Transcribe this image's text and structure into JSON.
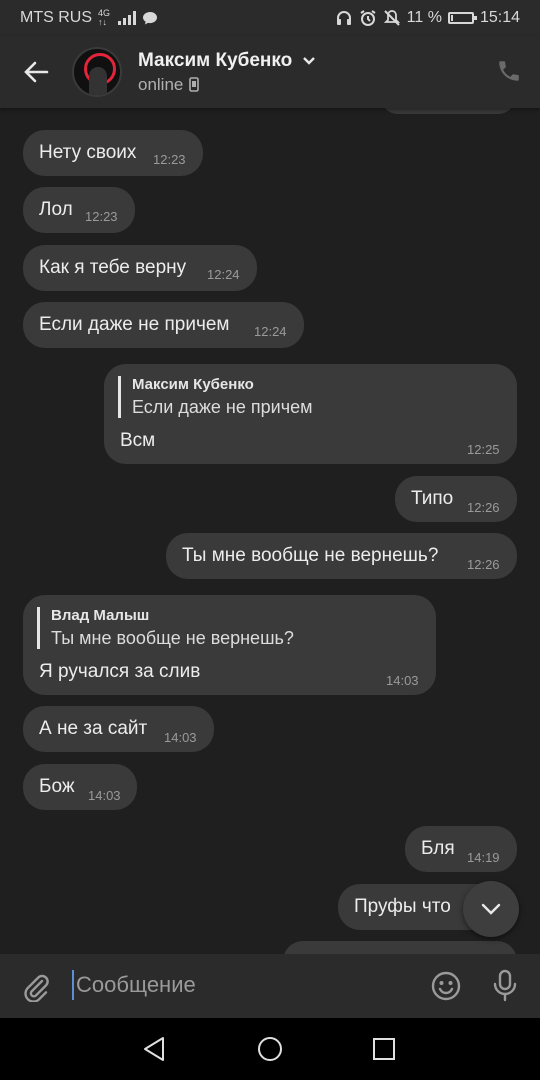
{
  "status_bar": {
    "carrier": "MTS RUS",
    "network_top": "4G",
    "network_bottom": "↑↓",
    "battery_percent": "11 %",
    "battery_level": 0.11,
    "time": "15:14",
    "icons": [
      "signal-icon",
      "message-icon",
      "headphones-icon",
      "alarm-icon",
      "mute-icon",
      "wifi-icon",
      "battery-icon"
    ]
  },
  "header": {
    "contact_name": "Максим Кубенко",
    "status": "online",
    "icons": [
      "back-arrow-icon",
      "chevron-down-icon",
      "mobile-device-icon",
      "phone-icon"
    ]
  },
  "messages": [
    {
      "side": "in",
      "text": "Нету своих",
      "time": "12:23"
    },
    {
      "side": "in",
      "text": "Лол",
      "time": "12:23"
    },
    {
      "side": "in",
      "text": "Как я тебе верну",
      "time": "12:24"
    },
    {
      "side": "in",
      "text": "Если даже не причем",
      "time": "12:24"
    },
    {
      "side": "out",
      "reply_name": "Максим Кубенко",
      "reply_text": "Если даже не причем",
      "text": "Всм",
      "time": "12:25"
    },
    {
      "side": "out",
      "text": "Типо",
      "time": "12:26"
    },
    {
      "side": "out",
      "text": "Ты мне вообще не вернешь?",
      "time": "12:26"
    },
    {
      "side": "in",
      "reply_name": "Влад Малыш",
      "reply_text": "Ты мне вообще не вернешь?",
      "text": "Я ручался за слив",
      "time": "14:03"
    },
    {
      "side": "in",
      "text": "А не за сайт",
      "time": "14:03"
    },
    {
      "side": "in",
      "text": "Бож",
      "time": "14:03"
    },
    {
      "side": "out",
      "text": "Бля",
      "time": "14:19"
    },
    {
      "side": "out",
      "text": "Пруфы что",
      "time": ""
    }
  ],
  "composer": {
    "placeholder": "Сообщение",
    "icons": [
      "attach-icon",
      "emoji-icon",
      "microphone-icon"
    ]
  },
  "scroll_down_icon": "chevron-down-icon",
  "nav_bar": {
    "icons": [
      "nav-back-icon",
      "nav-home-icon",
      "nav-recents-icon"
    ]
  },
  "colors": {
    "background": "#1f1f1f",
    "bubble": "#3a3a3a",
    "bars": "#2b2b2b",
    "accent_red": "#e2253a",
    "cursor": "#5b8fd8"
  }
}
